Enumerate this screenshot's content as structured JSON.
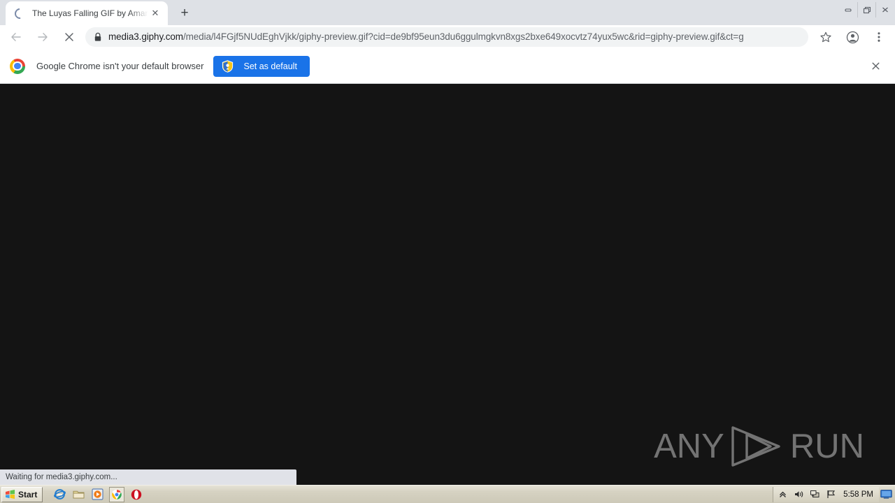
{
  "window": {
    "controls": [
      {
        "name": "minimize",
        "label": "–"
      },
      {
        "name": "restore",
        "label": "❐"
      },
      {
        "name": "close",
        "label": "✕"
      }
    ]
  },
  "tabstrip": {
    "tabs": [
      {
        "title": "The Luyas Falling GIF by Amanda Bo",
        "favicon": "loading-spinner-icon",
        "close_label": "✕",
        "loading": true
      }
    ],
    "new_tab_label": "+"
  },
  "toolbar": {
    "back_icon": "arrow-left-icon",
    "forward_icon": "arrow-right-icon",
    "stop_icon": "stop-x-icon",
    "security_icon": "lock-icon",
    "url_host": "media3.giphy.com",
    "url_path": "/media/l4FGjf5NUdEghVjkk/giphy-preview.gif?cid=de9bf95eun3du6ggulmgkvn8xgs2bxe649xocvtz74yux5wc&rid=giphy-preview.gif&ct=g",
    "bookmark_icon": "star-icon",
    "profile_icon": "account-avatar-icon",
    "menu_icon": "three-dot-menu-icon"
  },
  "infobar": {
    "brand_icon": "chrome-logo-icon",
    "message": "Google Chrome isn't your default browser",
    "button_label": "Set as default",
    "button_icon": "shield-icon",
    "button_color": "#1a73e8",
    "close_label": "✕"
  },
  "page": {
    "background_color": "#141414",
    "watermark": {
      "left_text": "ANY",
      "right_text": "RUN",
      "logo_icon": "anyrun-play-triangle-icon",
      "color": "#7c7c7c"
    }
  },
  "status": {
    "text": "Waiting for media3.giphy.com..."
  },
  "taskbar": {
    "start_label": "Start",
    "start_icon": "windows-flag-icon",
    "quick_launch": [
      {
        "name": "internet-explorer-icon",
        "label": "Internet Explorer"
      },
      {
        "name": "file-explorer-icon",
        "label": "Windows Explorer"
      },
      {
        "name": "media-player-icon",
        "label": "Windows Media Player"
      },
      {
        "name": "google-chrome-icon",
        "label": "Google Chrome",
        "active": true
      },
      {
        "name": "opera-icon",
        "label": "Opera"
      }
    ],
    "tray": {
      "icons": [
        "show-hidden-icons-chevron-icon",
        "volume-speaker-icon",
        "network-connection-icon",
        "flag-action-center-icon"
      ],
      "time": "5:58 PM",
      "show_desktop_icon": "show-desktop-icon"
    }
  }
}
